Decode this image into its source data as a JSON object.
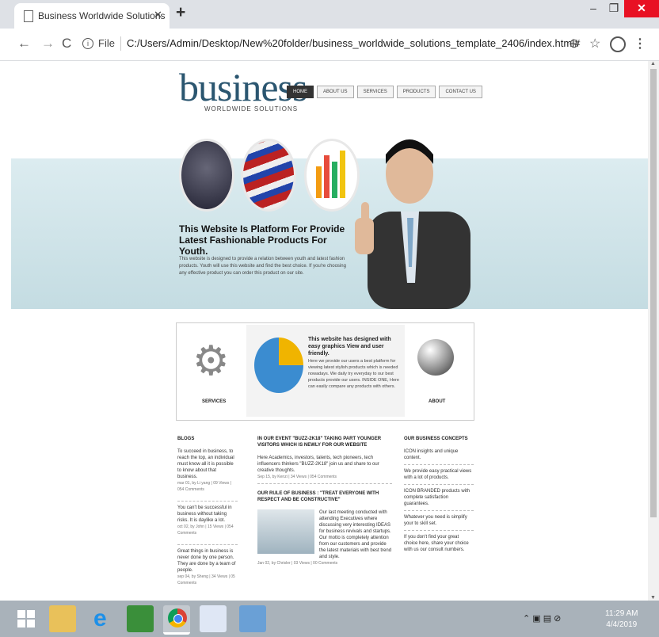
{
  "browser": {
    "tab_title": "Business Worldwide Solutions",
    "tab_close": "✕",
    "new_tab": "+",
    "window_min": "–",
    "window_max": "❐",
    "window_close": "✕",
    "nav_back": "←",
    "nav_forward": "→",
    "nav_reload": "C",
    "info": "i",
    "file_label": "File",
    "url": "C:/Users/Admin/Desktop/New%20folder/business_worldwide_solutions_template_2406/index.html#",
    "zoom": "⊖",
    "star": "☆",
    "menu": "⋮"
  },
  "site": {
    "logo": "business",
    "logo_sub": "WORLDWIDE SOLUTIONS",
    "nav": [
      "HOME",
      "ABOUT US",
      "SERVICES",
      "PRODUCTS",
      "CONTACT US"
    ],
    "hero_title": "This Website Is Platform For Provide Latest Fashionable Products For Youth.",
    "hero_body": "This website is designed to provide a relation between youth and latest fashion products. Youth will use this website and find the best choice. If you're choosing any effective product you can order this product on our site.",
    "features": {
      "services_label": "SERVICES",
      "about_label": "ABOUT",
      "heading": "This website has designed with easy graphics View and user friendly.",
      "text": "Here we provide our users a best platform for viewing latest stylish products which is needed nowadays. We daily try everyday to our best products provide our users. INSIDE ONE, Here can easily compare any products with others."
    },
    "blogs": {
      "heading": "BLOGS",
      "items": [
        {
          "text": "To succeed in business, to reach the top, an individual must know all it is possible to know about that business.",
          "meta": "mar 01, by Li yang | 09 Views | 054 Comments"
        },
        {
          "text": "You can't be successful in business without taking risks. It is daylike a lot.",
          "meta": "oct 02, by John | 15 Views | 054 Comments"
        },
        {
          "text": "Great things in business is never done by one person. They are done by a team of people.",
          "meta": "sep 04, by Sheng | 34 Views | 05 Comments"
        }
      ]
    },
    "news": {
      "item1_title": "IN OUR EVENT \"BUZZ-2K18\" TAKING PART YOUNGER VISITORS WHICH IS NEWLY FOR OUR WEBSITE",
      "item1_text": "Here Academics, investors, talents, tech pioneers, tech influencers thinkers \"BUZZ-2K18\" join us and share to our creative thoughts.",
      "item1_meta": "Sep 15, by Kenzi | 34 Views | 054 Comments",
      "item2_title": "OUR RULE OF BUSINESS : \"TREAT EVERYONE WITH RESPECT AND BE CONSTRUCTIVE\"",
      "item2_text": "Our last meeting conducted with attending Executives where discussing very interesting IDEAS for business revivals and startups. Our motto is completely attention from our customers and provide the latest materials with best trend and style.",
      "item2_meta": "Jan 02, by Chrisler | 03 Views | 00 Comments"
    },
    "consider": {
      "heading": "OUR BUSINESS CONCEPTS",
      "items": [
        "ICON insights and unique content.",
        "We provide easy practical views with a lot of products.",
        "ICON BRANDED products with complete satisfaction guarantees.",
        "Whatever you need is simplify your to skill set.",
        "If you don't find your great choice here, share your choice with us our consult numbers."
      ]
    }
  },
  "taskbar": {
    "tray_icons": "⌃ ▣ ▤ ⊘",
    "time": "11:29 AM",
    "date": "4/4/2019"
  },
  "colors": {
    "tab_strip": "#dee1e6",
    "hero_band": "#c4dce2",
    "logo": "#2b5670",
    "close_button": "#e81123",
    "taskbar": "#a9b2ba"
  }
}
